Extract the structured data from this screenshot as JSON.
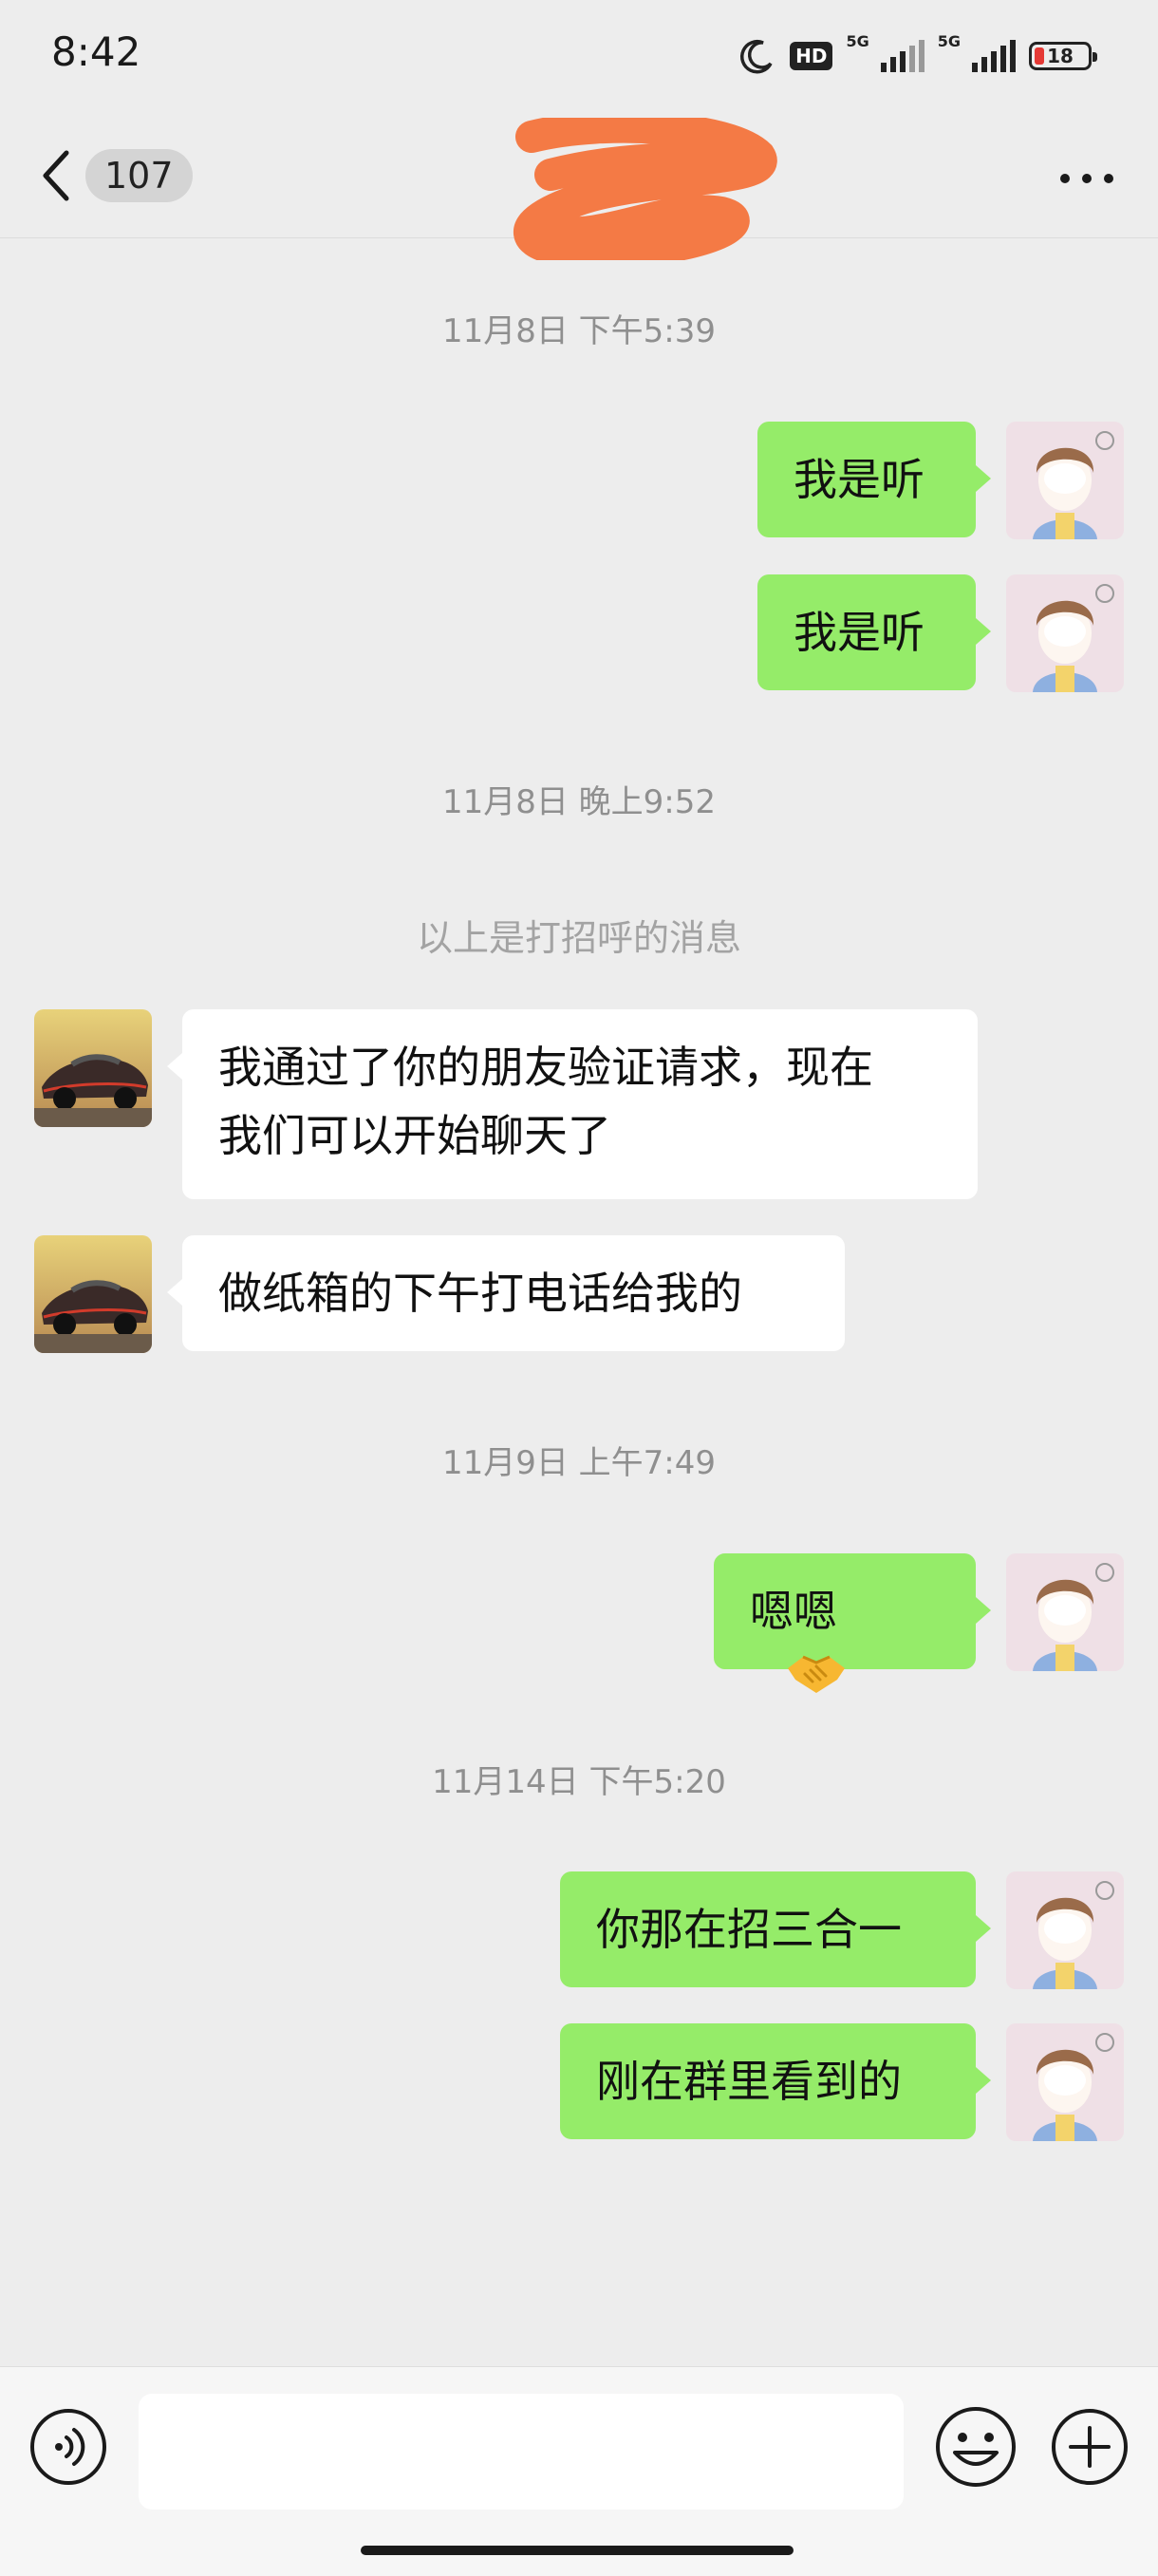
{
  "status_bar": {
    "time": "8:42",
    "hd_label": "HD",
    "network_1": "5G",
    "network_2": "5G",
    "battery": "18",
    "battery_level": 0.18
  },
  "header": {
    "unread_count": "107",
    "title": "",
    "title_redacted": true
  },
  "messages": [
    {
      "type": "timestamp",
      "text": "11月8日 下午5:39"
    },
    {
      "type": "message",
      "side": "me",
      "text": "我是听"
    },
    {
      "type": "message",
      "side": "me",
      "text": "我是听"
    },
    {
      "type": "timestamp",
      "text": "11月8日 晚上9:52"
    },
    {
      "type": "system",
      "text": "以上是打招呼的消息"
    },
    {
      "type": "message",
      "side": "them",
      "lines": [
        "我通过了你的朋友验证请求，现在",
        "我们可以开始聊天了"
      ]
    },
    {
      "type": "message",
      "side": "them",
      "text": "做纸箱的下午打电话给我的"
    },
    {
      "type": "timestamp",
      "text": "11月9日 上午7:49"
    },
    {
      "type": "message",
      "side": "me",
      "text": "嗯嗯",
      "emoji": "handshake-emoji"
    },
    {
      "type": "timestamp",
      "text": "11月14日 下午5:20"
    },
    {
      "type": "message",
      "side": "me",
      "text": "你那在招三合一"
    },
    {
      "type": "message",
      "side": "me",
      "text": "刚在群里看到的"
    }
  ],
  "input_bar": {
    "placeholder": "",
    "icons": [
      "voice-icon",
      "emoji-icon",
      "plus-icon"
    ]
  },
  "colors": {
    "background": "#ededed",
    "my_bubble": "#95ec69",
    "their_bubble": "#ffffff",
    "timestamp": "#8f8f8f",
    "redaction_scribble": "#f47a45"
  }
}
